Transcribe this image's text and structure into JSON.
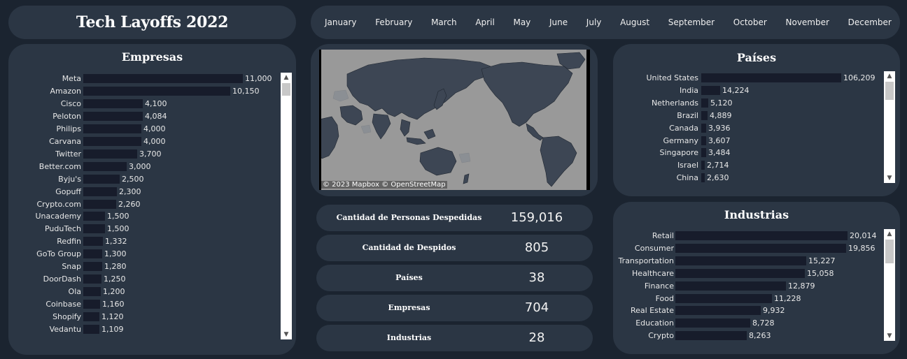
{
  "title": "Tech Layoffs 2022",
  "months": [
    "January",
    "February",
    "March",
    "April",
    "May",
    "June",
    "July",
    "August",
    "September",
    "October",
    "November",
    "December"
  ],
  "empresas": {
    "title": "Empresas",
    "max": 11000,
    "items": [
      {
        "label": "Meta",
        "value": 11000,
        "display": "11,000"
      },
      {
        "label": "Amazon",
        "value": 10150,
        "display": "10,150"
      },
      {
        "label": "Cisco",
        "value": 4100,
        "display": "4,100"
      },
      {
        "label": "Peloton",
        "value": 4084,
        "display": "4,084"
      },
      {
        "label": "Philips",
        "value": 4000,
        "display": "4,000"
      },
      {
        "label": "Carvana",
        "value": 4000,
        "display": "4,000"
      },
      {
        "label": "Twitter",
        "value": 3700,
        "display": "3,700"
      },
      {
        "label": "Better.com",
        "value": 3000,
        "display": "3,000"
      },
      {
        "label": "Byju's",
        "value": 2500,
        "display": "2,500"
      },
      {
        "label": "Gopuff",
        "value": 2300,
        "display": "2,300"
      },
      {
        "label": "Crypto.com",
        "value": 2260,
        "display": "2,260"
      },
      {
        "label": "Unacademy",
        "value": 1500,
        "display": "1,500"
      },
      {
        "label": "PuduTech",
        "value": 1500,
        "display": "1,500"
      },
      {
        "label": "Redfin",
        "value": 1332,
        "display": "1,332"
      },
      {
        "label": "GoTo Group",
        "value": 1300,
        "display": "1,300"
      },
      {
        "label": "Snap",
        "value": 1280,
        "display": "1,280"
      },
      {
        "label": "DoorDash",
        "value": 1250,
        "display": "1,250"
      },
      {
        "label": "Ola",
        "value": 1200,
        "display": "1,200"
      },
      {
        "label": "Coinbase",
        "value": 1160,
        "display": "1,160"
      },
      {
        "label": "Shopify",
        "value": 1120,
        "display": "1,120"
      },
      {
        "label": "Vedantu",
        "value": 1109,
        "display": "1,109"
      }
    ]
  },
  "paises": {
    "title": "Países",
    "max": 106209,
    "items": [
      {
        "label": "United States",
        "value": 106209,
        "display": "106,209"
      },
      {
        "label": "India",
        "value": 14224,
        "display": "14,224"
      },
      {
        "label": "Netherlands",
        "value": 5120,
        "display": "5,120"
      },
      {
        "label": "Brazil",
        "value": 4889,
        "display": "4,889"
      },
      {
        "label": "Canada",
        "value": 3936,
        "display": "3,936"
      },
      {
        "label": "Germany",
        "value": 3607,
        "display": "3,607"
      },
      {
        "label": "Singapore",
        "value": 3484,
        "display": "3,484"
      },
      {
        "label": "Israel",
        "value": 2714,
        "display": "2,714"
      },
      {
        "label": "China",
        "value": 2630,
        "display": "2,630"
      }
    ]
  },
  "industrias": {
    "title": "Industrias",
    "max": 20014,
    "items": [
      {
        "label": "Retail",
        "value": 20014,
        "display": "20,014"
      },
      {
        "label": "Consumer",
        "value": 19856,
        "display": "19,856"
      },
      {
        "label": "Transportation",
        "value": 15227,
        "display": "15,227"
      },
      {
        "label": "Healthcare",
        "value": 15058,
        "display": "15,058"
      },
      {
        "label": "Finance",
        "value": 12879,
        "display": "12,879"
      },
      {
        "label": "Food",
        "value": 11228,
        "display": "11,228"
      },
      {
        "label": "Real Estate",
        "value": 9932,
        "display": "9,932"
      },
      {
        "label": "Education",
        "value": 8728,
        "display": "8,728"
      },
      {
        "label": "Crypto",
        "value": 8263,
        "display": "8,263"
      }
    ]
  },
  "map": {
    "credit": "© 2023 Mapbox  © OpenStreetMap"
  },
  "kpis": [
    {
      "label": "Cantidad de Personas Despedidas",
      "value": "159,016"
    },
    {
      "label": "Cantidad de Despidos",
      "value": "805"
    },
    {
      "label": "Países",
      "value": "38"
    },
    {
      "label": "Empresas",
      "value": "704"
    },
    {
      "label": "Industrias",
      "value": "28"
    }
  ],
  "colors": {
    "background": "#1b2430",
    "panel": "#2b3644",
    "bar": "#171c2b",
    "map_water": "#999999",
    "map_land": "#3d4654"
  }
}
